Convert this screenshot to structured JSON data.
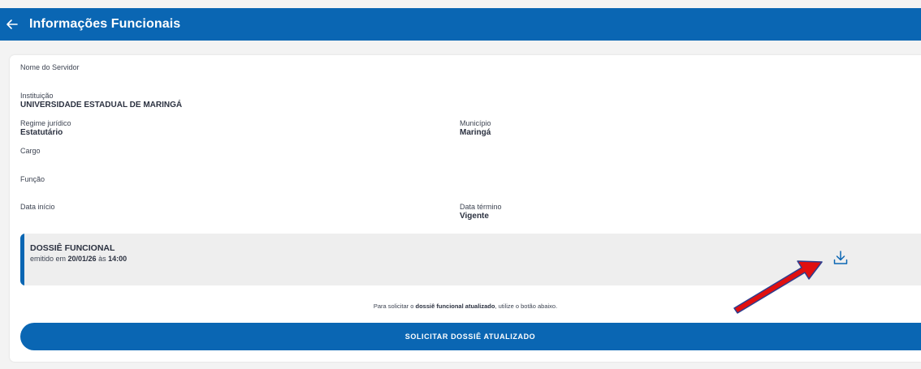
{
  "header": {
    "title": "Informações Funcionais"
  },
  "fields": {
    "nome": {
      "label": "Nome do Servidor",
      "value": ""
    },
    "instituicao": {
      "label": "Instituição",
      "value": "UNIVERSIDADE ESTADUAL DE MARINGÁ"
    },
    "regime": {
      "label": "Regime jurídico",
      "value": "Estatutário"
    },
    "municipio": {
      "label": "Município",
      "value": "Maringá"
    },
    "cargo": {
      "label": "Cargo",
      "value": ""
    },
    "funcao": {
      "label": "Função",
      "value": ""
    },
    "data_inicio": {
      "label": "Data início",
      "value": ""
    },
    "data_termino": {
      "label": "Data término",
      "value": "Vigente"
    }
  },
  "dossie": {
    "title": "DOSSIÊ FUNCIONAL",
    "emitido_prefix": "emitido em",
    "date": "20/01/26",
    "at": "às",
    "time": "14:00"
  },
  "hint": {
    "prefix": "Para solicitar o",
    "bold": "dossiê funcional atualizado",
    "suffix": ", utilize o botão abaixo."
  },
  "button": {
    "label": "SOLICITAR DOSSIÊ ATUALIZADO"
  },
  "colors": {
    "primary": "#0a66b3",
    "annotation_arrow": "#e01010"
  }
}
